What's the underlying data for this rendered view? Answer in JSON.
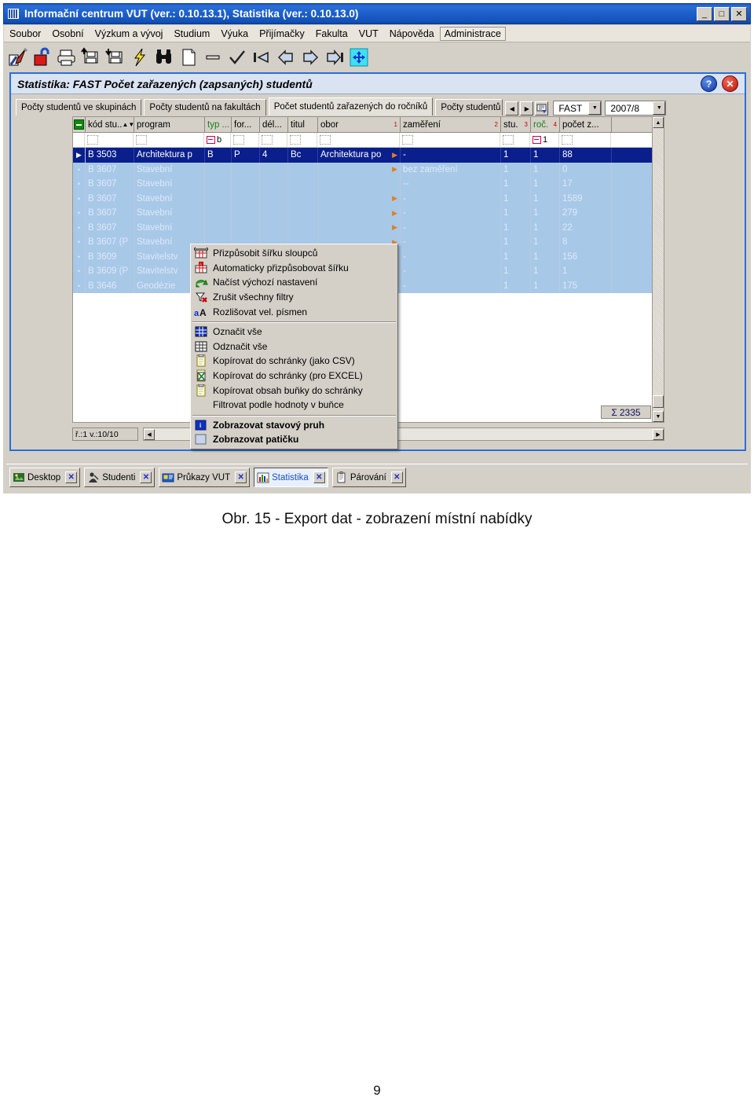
{
  "window": {
    "title": "Informační centrum VUT (ver.: 0.10.13.1), Statistika (ver.: 0.10.13.0)",
    "buttons": {
      "minimize": "_",
      "maximize": "□",
      "close": "✕"
    }
  },
  "menubar": [
    "Soubor",
    "Osobní",
    "Výzkum a vývoj",
    "Studium",
    "Výuka",
    "Přijímačky",
    "Fakulta",
    "VUT",
    "Nápověda",
    "Administrace"
  ],
  "toolbar_icons": [
    "edit-pen-icon",
    "lock-open-icon",
    "print-icon",
    "save-up-icon",
    "save-down-icon",
    "lightning-icon",
    "binoculars-icon",
    "new-document-icon",
    "delete-minus-icon",
    "confirm-check-icon",
    "first-record-icon",
    "previous-record-icon",
    "next-record-icon",
    "last-record-icon",
    "move-resize-icon"
  ],
  "app": {
    "caption": "Statistika: FAST Počet zařazených (zapsaných) studentů",
    "help_icon": "?",
    "close_icon": "✕"
  },
  "tabs": [
    {
      "label": "Počty studentů ve skupinách",
      "active": false
    },
    {
      "label": "Počty studentů na fakultách",
      "active": false
    },
    {
      "label": "Počet studentů zařazených do ročníků",
      "active": true
    },
    {
      "label": "Počty studentů",
      "active": false
    }
  ],
  "tab_nav": {
    "prev": "◀",
    "next": "▶",
    "list_icon": "tab-list-icon"
  },
  "selectors": {
    "faculty": {
      "value": "FAST",
      "arrow": "▼"
    },
    "year": {
      "value": "2007/8",
      "arrow": "▼"
    }
  },
  "grid": {
    "columns": [
      {
        "label": "kód stu..",
        "marker": "sort-marker",
        "green": false
      },
      {
        "label": "program",
        "marker": "",
        "green": false
      },
      {
        "label": "typ ...",
        "marker": "",
        "green": true
      },
      {
        "label": "for...",
        "marker": "",
        "green": false
      },
      {
        "label": "dél...",
        "marker": "",
        "green": false
      },
      {
        "label": "titul",
        "marker": "",
        "green": false
      },
      {
        "label": "obor",
        "marker": "1",
        "green": false
      },
      {
        "label": "zaměření",
        "marker": "2",
        "green": false
      },
      {
        "label": "stu.",
        "marker": "3",
        "green": false
      },
      {
        "label": "roč.",
        "marker": "4",
        "green": true
      },
      {
        "label": "počet z...",
        "marker": "",
        "green": false
      }
    ],
    "filter_row": {
      "typ": "b",
      "roc": "1"
    },
    "rows": [
      {
        "kod": "B 3503",
        "program": "Architektura p",
        "typ": "B",
        "forma": "P",
        "del": "4",
        "titul": "Bc",
        "obor": "Architektura po",
        "zamereni": "-",
        "stu": "1",
        "roc": "1",
        "pocet": "88",
        "selected": true,
        "obor_arrow": true
      },
      {
        "kod": "B 3607",
        "program": "Stavební",
        "typ": "",
        "forma": "",
        "del": "",
        "titul": "",
        "obor": "",
        "zamereni": "bez zaměření",
        "stu": "1",
        "roc": "1",
        "pocet": "0",
        "selected": false,
        "obor_arrow": true
      },
      {
        "kod": "B 3607",
        "program": "Stavební",
        "typ": "",
        "forma": "",
        "del": "",
        "titul": "",
        "obor": "",
        "zamereni": "--",
        "stu": "1",
        "roc": "1",
        "pocet": "17",
        "selected": false,
        "obor_arrow": false
      },
      {
        "kod": "B 3607",
        "program": "Stavební",
        "typ": "",
        "forma": "",
        "del": "",
        "titul": "",
        "obor": "",
        "zamereni": "-",
        "stu": "1",
        "roc": "1",
        "pocet": "1589",
        "selected": false,
        "obor_arrow": true
      },
      {
        "kod": "B 3607",
        "program": "Stavební",
        "typ": "",
        "forma": "",
        "del": "",
        "titul": "",
        "obor": "",
        "zamereni": "-",
        "stu": "1",
        "roc": "1",
        "pocet": "279",
        "selected": false,
        "obor_arrow": true
      },
      {
        "kod": "B 3607",
        "program": "Stavební",
        "typ": "",
        "forma": "",
        "del": "",
        "titul": "",
        "obor": "",
        "zamereni": "-",
        "stu": "1",
        "roc": "1",
        "pocet": "22",
        "selected": false,
        "obor_arrow": true
      },
      {
        "kod": "B 3607 (P",
        "program": "Stavební",
        "typ": "",
        "forma": "",
        "del": "",
        "titul": "",
        "obor": "",
        "zamereni": "-",
        "stu": "1",
        "roc": "1",
        "pocet": "8",
        "selected": false,
        "obor_arrow": true
      },
      {
        "kod": "B 3609",
        "program": "Stavitelstv",
        "typ": "",
        "forma": "",
        "del": "",
        "titul": "",
        "obor": "",
        "zamereni": "-",
        "stu": "1",
        "roc": "1",
        "pocet": "156",
        "selected": false,
        "obor_arrow": true
      },
      {
        "kod": "B 3609 (P",
        "program": "Stavitelstv",
        "typ": "",
        "forma": "",
        "del": "",
        "titul": "",
        "obor": "",
        "zamereni": "-",
        "stu": "1",
        "roc": "1",
        "pocet": "1",
        "selected": false,
        "obor_arrow": true
      },
      {
        "kod": "B 3646",
        "program": "Geodézie",
        "typ": "",
        "forma": "",
        "del": "",
        "titul": "",
        "obor": "",
        "zamereni": "-",
        "stu": "1",
        "roc": "1",
        "pocet": "175",
        "selected": false,
        "obor_arrow": true
      }
    ],
    "sum": {
      "symbol": "Σ",
      "value": "2335"
    },
    "status": "ř.:1 v.:10/10"
  },
  "context_menu": [
    {
      "label": "Přizpůsobit šířku sloupců",
      "icon": "fit-column-width-icon",
      "bold": false
    },
    {
      "label": "Automaticky přizpůsobovat šířku",
      "icon": "auto-fit-width-icon",
      "bold": false
    },
    {
      "label": "Načíst výchozí nastavení",
      "icon": "reload-default-icon",
      "bold": false
    },
    {
      "label": "Zrušit všechny filtry",
      "icon": "clear-filters-icon",
      "bold": false
    },
    {
      "label": "Rozlišovat vel. písmen",
      "icon": "match-case-icon",
      "bold": false
    },
    {
      "separator": true
    },
    {
      "label": "Označit vše",
      "icon": "select-all-icon",
      "bold": false
    },
    {
      "label": "Odznačit vše",
      "icon": "deselect-all-icon",
      "bold": false
    },
    {
      "label": "Kopírovat do schránky (jako CSV)",
      "icon": "copy-csv-icon",
      "bold": false
    },
    {
      "label": "Kopírovat do schránky (pro EXCEL)",
      "icon": "copy-excel-icon",
      "bold": false
    },
    {
      "label": "Kopírovat obsah buňky do schránky",
      "icon": "copy-cell-icon",
      "bold": false
    },
    {
      "label": "Filtrovat podle hodnoty v buňce",
      "icon": "",
      "bold": false
    },
    {
      "separator": true
    },
    {
      "label": "Zobrazovat stavový pruh",
      "icon": "status-bar-icon",
      "bold": true
    },
    {
      "label": "Zobrazovat patičku",
      "icon": "footer-icon",
      "bold": true
    }
  ],
  "taskbar": [
    {
      "label": "Desktop",
      "icon": "desktop-icon",
      "active": false,
      "close": "✕"
    },
    {
      "label": "Studenti",
      "icon": "students-icon",
      "active": false,
      "close": "✕"
    },
    {
      "label": "Průkazy VUT",
      "icon": "cards-icon",
      "active": false,
      "close": "✕"
    },
    {
      "label": "Statistika",
      "icon": "statistics-icon",
      "active": true,
      "close": "✕"
    },
    {
      "label": "Párování",
      "icon": "pairing-icon",
      "active": false,
      "close": "✕"
    }
  ],
  "figure_caption": "Obr. 15 - Export dat - zobrazení místní nabídky",
  "page_number": "9",
  "colors": {
    "titlebar": "#1d5ec9",
    "selection": "#0a1f8c",
    "highlight": "#a8c8e8",
    "face": "#d4d0c8",
    "accent_red": "#cc0000",
    "accent_green": "#1a7d1a"
  }
}
